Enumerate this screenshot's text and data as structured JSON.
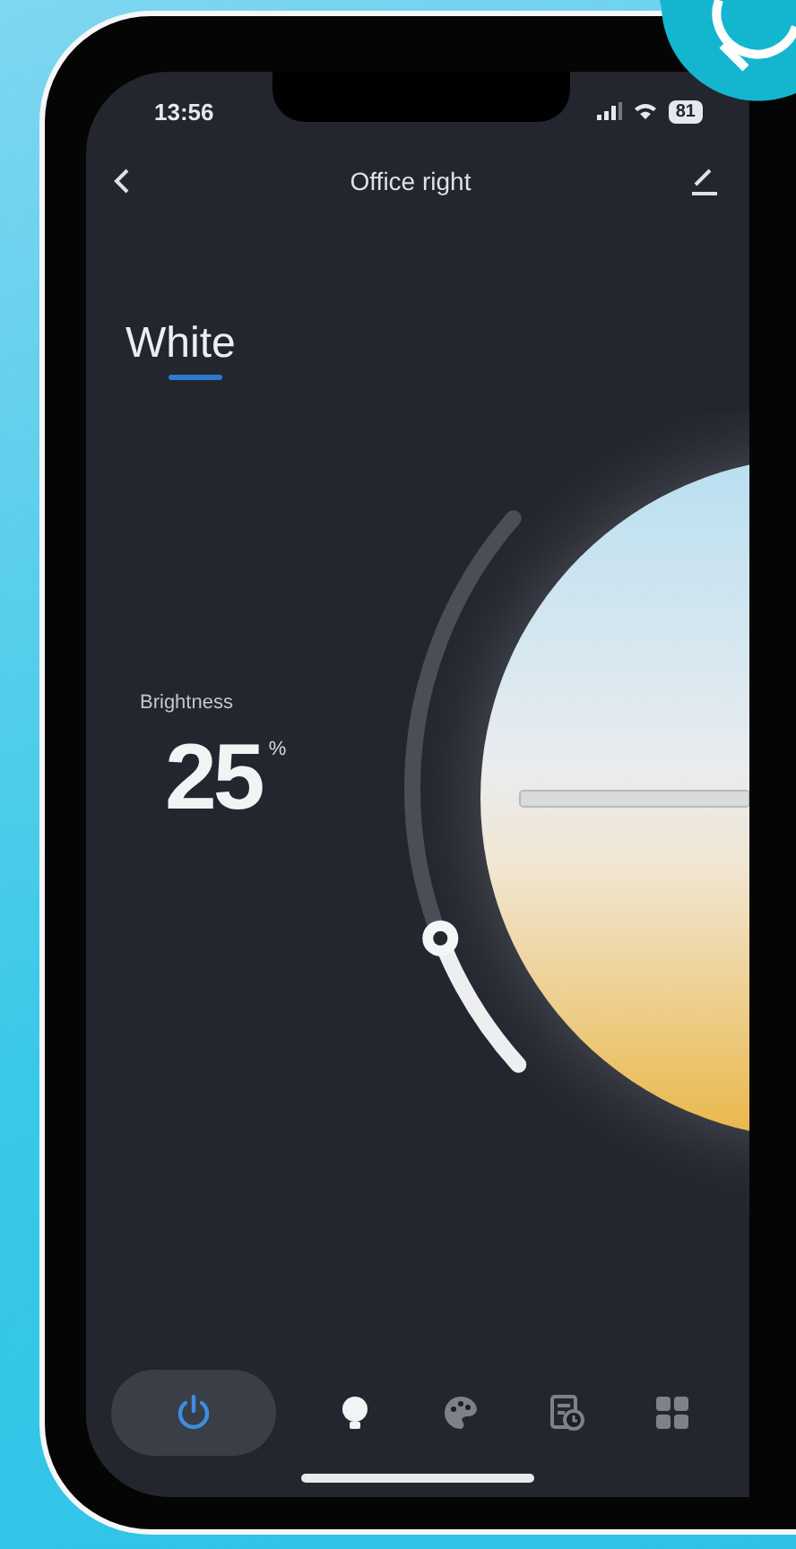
{
  "status_bar": {
    "time": "13:56",
    "battery": "81"
  },
  "header": {
    "title": "Office right"
  },
  "mode_tabs": [
    {
      "label": "White",
      "selected": true
    }
  ],
  "brightness": {
    "label": "Brightness",
    "value": "25",
    "unit": "%",
    "level": 0.25
  },
  "power": {
    "on": true
  },
  "tab_bar": [
    {
      "kind": "bulb",
      "selected": true
    },
    {
      "kind": "palette",
      "selected": false
    },
    {
      "kind": "schedule",
      "selected": false
    },
    {
      "kind": "grid",
      "selected": false
    }
  ]
}
